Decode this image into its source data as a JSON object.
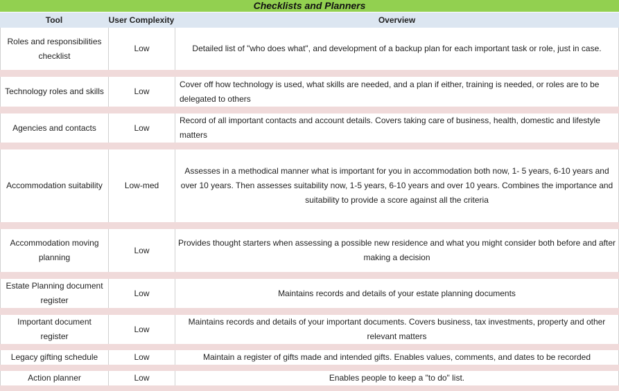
{
  "title": "Checklists and Planners",
  "columns": {
    "tool": "Tool",
    "complexity": "User Complexity",
    "overview": "Overview"
  },
  "colors": {
    "title_bar": "#92d050",
    "header": "#dce6f1",
    "separator": "#f0dada"
  },
  "rows": [
    {
      "tool": "Roles and responsibilities checklist",
      "complexity": "Low",
      "overview": "Detailed list of \"who does what\", and development of a backup plan for each important task or role, just in case."
    },
    {
      "tool": "Technology roles and skills",
      "complexity": "Low",
      "overview": "Cover off how technology is used, what skills are needed, and a plan if either, training is needed, or roles are to be delegated to others"
    },
    {
      "tool": "Agencies and contacts",
      "complexity": "Low",
      "overview": "Record of all important contacts and account details. Covers taking care of business, health, domestic and lifestyle matters"
    },
    {
      "tool": "Accommodation suitability",
      "complexity": "Low-med",
      "overview": "Assesses in a methodical manner what is important for you in accommodation both now, 1- 5 years, 6-10 years and over 10 years. Then assesses suitability now, 1-5 years, 6-10 years and over 10 years. Combines the importance and suitability to provide a score against all the criteria"
    },
    {
      "tool": "Accommodation moving planning",
      "complexity": "Low",
      "overview": "Provides thought starters when assessing a possible new residence and what you might consider both before and after making a decision"
    },
    {
      "tool": "Estate Planning document register",
      "complexity": "Low",
      "overview": "Maintains records and details of your estate planning documents"
    },
    {
      "tool": "Important document register",
      "complexity": "Low",
      "overview": "Maintains records and details of your important documents. Covers business, tax investments, property and other relevant matters"
    },
    {
      "tool": "Legacy gifting schedule",
      "complexity": "Low",
      "overview": "Maintain a register of gifts made and intended gifts. Enables values, comments, and dates to be recorded"
    },
    {
      "tool": "Action planner",
      "complexity": "Low",
      "overview": "Enables people to keep a \"to do\" list."
    }
  ]
}
